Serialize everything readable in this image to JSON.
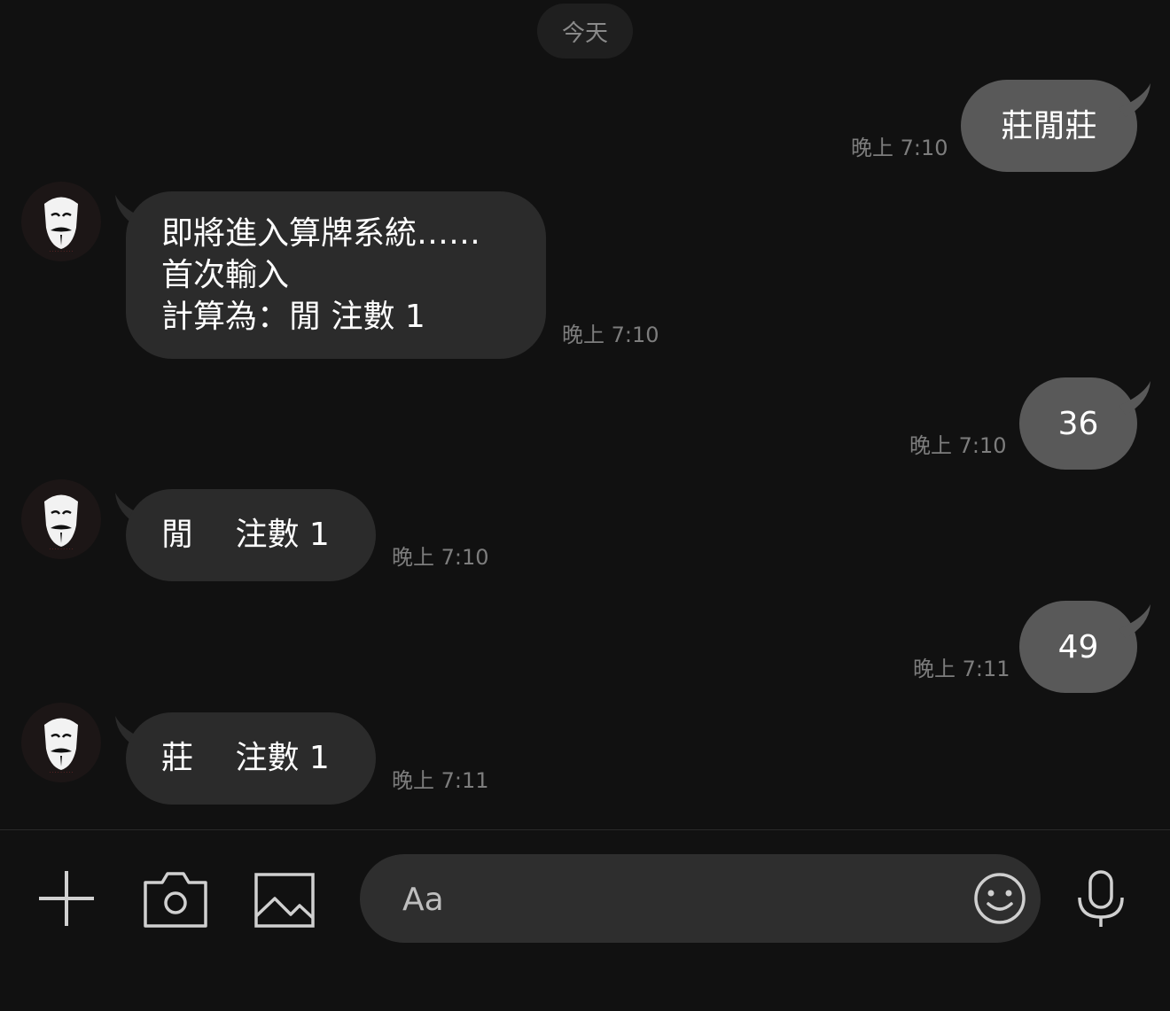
{
  "date_divider": "今天",
  "messages": [
    {
      "dir": "out",
      "text": "莊閒莊",
      "time": "晚上 7:10"
    },
    {
      "dir": "in",
      "text": "即將進入算牌系統……\n首次輸入\n計算為：閒 注數 1",
      "time": "晚上 7:10"
    },
    {
      "dir": "out",
      "text": "36",
      "time": "晚上 7:10"
    },
    {
      "dir": "in",
      "text": "閒　 注數 1",
      "time": "晚上 7:10"
    },
    {
      "dir": "out",
      "text": "49",
      "time": "晚上 7:11"
    },
    {
      "dir": "in",
      "text": "莊　 注數 1",
      "time": "晚上 7:11"
    }
  ],
  "composer": {
    "placeholder": "Aa"
  },
  "icons": {
    "plus": "plus-icon",
    "camera": "camera-icon",
    "image": "image-icon",
    "emoji": "emoji-icon",
    "mic": "microphone-icon"
  },
  "colors": {
    "background": "#111111",
    "outgoing_bubble": "#595959",
    "incoming_bubble": "#2b2b2b",
    "timestamp": "#7d7d7d"
  }
}
